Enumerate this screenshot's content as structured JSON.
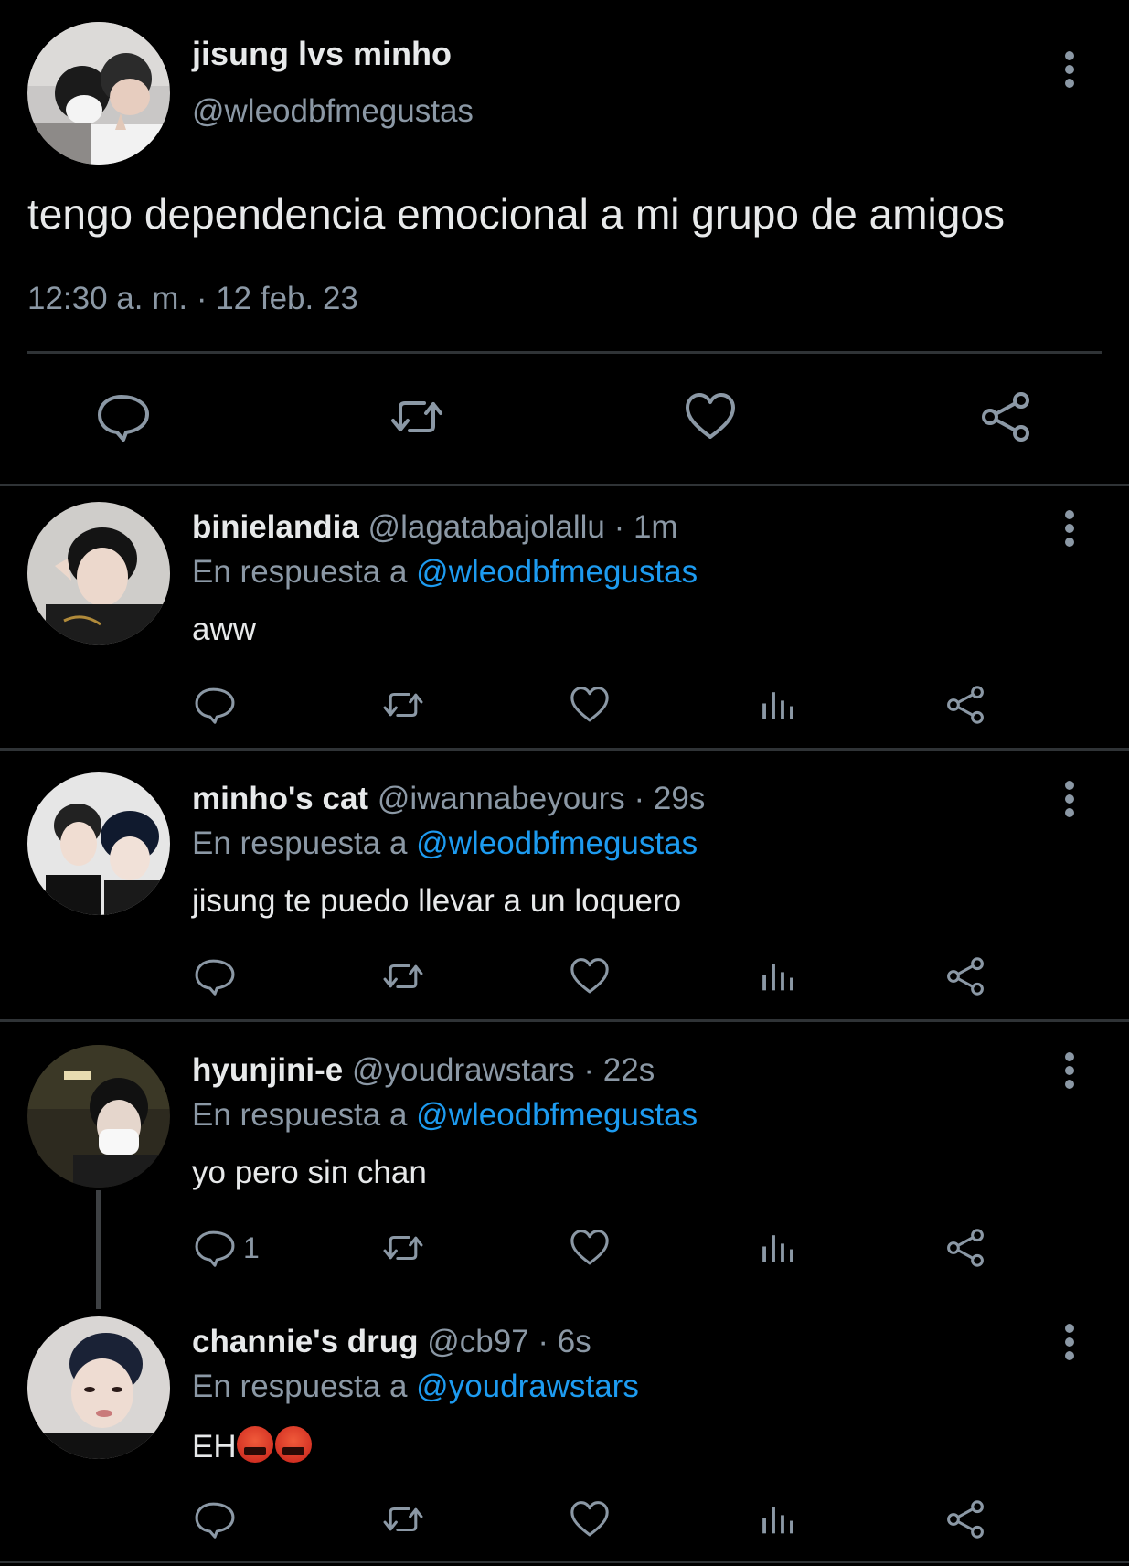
{
  "main_tweet": {
    "display_name": "jisung lvs minho",
    "handle": "@wleodbfmegustas",
    "text": "tengo dependencia emocional a mi grupo de amigos",
    "timestamp": "12:30 a. m. · 12 feb. 23"
  },
  "replies": [
    {
      "display_name": "binielandia",
      "meta": "@lagatabajolallu · 1m",
      "reply_prefix": "En respuesta a",
      "reply_to": "@wleodbfmegustas",
      "text": "aww",
      "reply_count": ""
    },
    {
      "display_name": "minho's cat",
      "meta": "@iwannabeyours · 29s",
      "reply_prefix": "En respuesta a",
      "reply_to": "@wleodbfmegustas",
      "text": "jisung te puedo llevar a un loquero",
      "reply_count": ""
    },
    {
      "display_name": "hyunjini-e",
      "meta": "@youdrawstars · 22s",
      "reply_prefix": "En respuesta a",
      "reply_to": "@wleodbfmegustas",
      "text": "yo pero sin chan",
      "reply_count": "1"
    },
    {
      "display_name": "channie's drug",
      "meta": "@cb97 · 6s",
      "reply_prefix": "En respuesta a",
      "reply_to": "@youdrawstars",
      "text": "EH",
      "text_emoji": [
        "angry-swearing-face",
        "angry-swearing-face"
      ],
      "reply_count": ""
    }
  ],
  "icons": {
    "reply": "speech-bubble-icon",
    "retweet": "retweet-arrows-icon",
    "like": "heart-icon",
    "views": "bar-chart-icon",
    "share": "share-nodes-icon",
    "more": "vertical-dots-icon"
  },
  "colors": {
    "background": "#000000",
    "text": "#e7e9ea",
    "secondary": "#8b98a5",
    "link": "#1d9bf0",
    "divider": "#2f3336"
  }
}
